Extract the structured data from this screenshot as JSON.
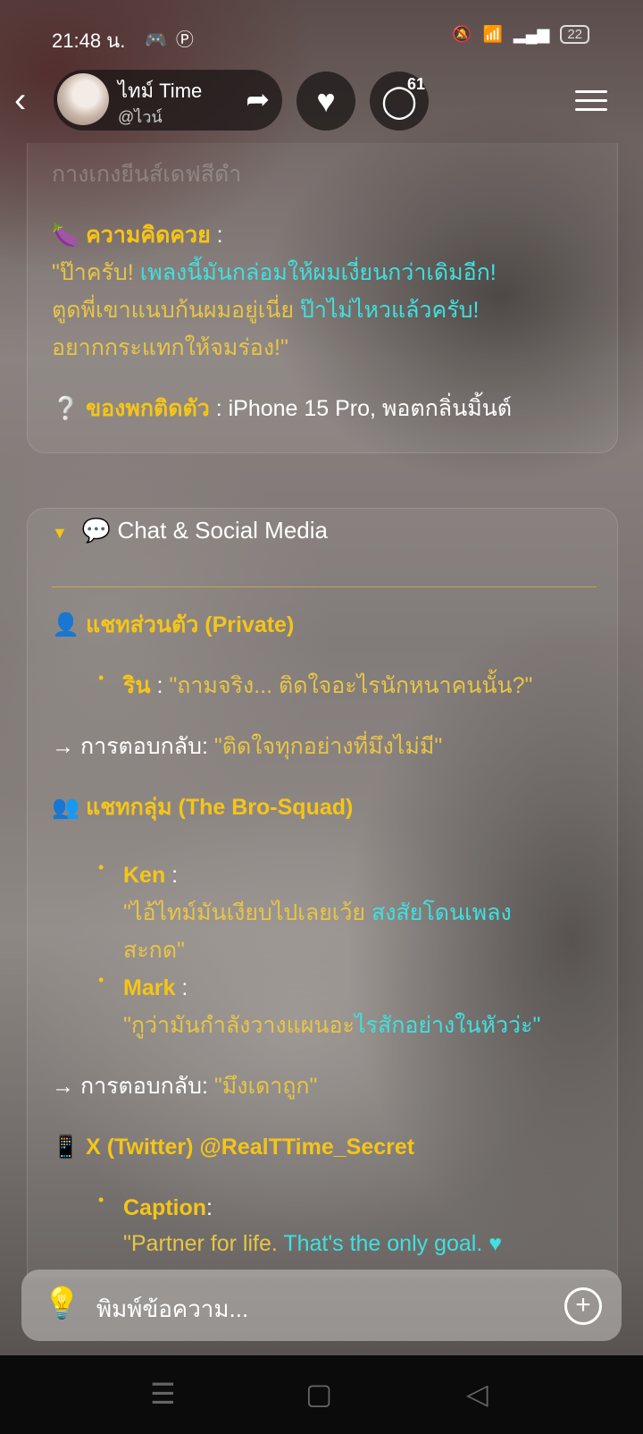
{
  "status": {
    "time": "21:48 น.",
    "battery": "22"
  },
  "profile": {
    "name": "ไทม์ Time",
    "handle": "@ไวน์"
  },
  "comments": {
    "count": "61"
  },
  "card1": {
    "faded_line": "กางเกงยีนส์เดฟสีดำ",
    "idea_label": "ความคิดควย",
    "idea_colon": " :",
    "idea_quote_1a": "\"ป๊าครับ! ",
    "idea_quote_1b": "เพลงนี้มันกล่อมให้ผมเงี่ยนกว่าเดิมอีก!",
    "idea_quote_2a": "ตูดพี่เขาแนบก้นผมอยู่เนี่ย ",
    "idea_quote_2b": "ป๊าไม่ไหวแล้วครับ!",
    "idea_quote_3": "อยากกระแทกให้จมร่อง!\"",
    "item_label": "ของพกติดตัว",
    "item_value": " : iPhone 15 Pro, พอตกลิ่นมิ้นต์"
  },
  "chat": {
    "section_title": "Chat & Social Media",
    "private_label": "แชทส่วนตัว (Private)",
    "rin_name": "ริน",
    "rin_colon": " : ",
    "rin_quote": "\"ถามจริง... ติดใจอะไรนักหนาคนนั้น?\"",
    "reply_label_1": "→ การตอบกลับ: ",
    "reply_value_1": "\"ติดใจทุกอย่างที่มึงไม่มี\"",
    "group_label": "แชทกลุ่ม (The Bro-Squad)",
    "ken_name": "Ken",
    "ken_colon": " :",
    "ken_quote_1a": "\"ไอ้ไทม์มันเงียบไปเลยเว้ย ",
    "ken_quote_1b": "สงสัยโดนเพลง",
    "ken_quote_2": "สะกด\"",
    "mark_name": "Mark",
    "mark_colon": " :",
    "mark_quote_a": "\"กูว่ามันกำลังวางแผนอะ",
    "mark_quote_b": "ไรสักอย่างในหัวว่ะ\"",
    "reply_label_2": "→ การตอบกลับ: ",
    "reply_value_2": "\"มึงเดาถูก\"",
    "twitter_label": "X (Twitter) @RealTTime_Secret",
    "caption_label": "Caption",
    "caption_colon": ":",
    "caption_quote_a": "\"Partner for life. ",
    "caption_quote_b": "That's the only goal."
  },
  "input": {
    "placeholder": "พิมพ์ข้อความ..."
  }
}
